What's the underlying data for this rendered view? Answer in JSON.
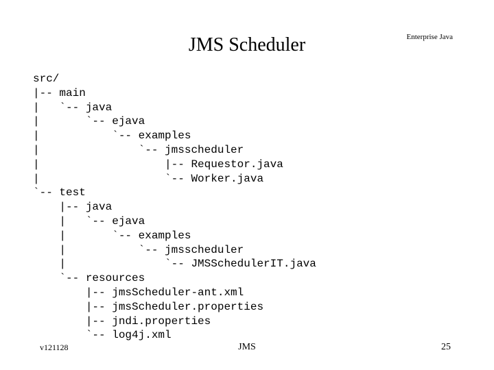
{
  "header": {
    "title": "JMS Scheduler",
    "subtitle": "Enterprise\nJava"
  },
  "tree": "src/\n|-- main\n|   `-- java\n|       `-- ejava\n|           `-- examples\n|               `-- jmsscheduler\n|                   |-- Requestor.java\n|                   `-- Worker.java\n`-- test\n    |-- java\n    |   `-- ejava\n    |       `-- examples\n    |           `-- jmsscheduler\n    |               `-- JMSSchedulerIT.java\n    `-- resources\n        |-- jmsScheduler-ant.xml\n        |-- jmsScheduler.properties\n        |-- jndi.properties\n        `-- log4j.xml",
  "footer": {
    "version": "v121128",
    "label": "JMS",
    "page": "25"
  }
}
